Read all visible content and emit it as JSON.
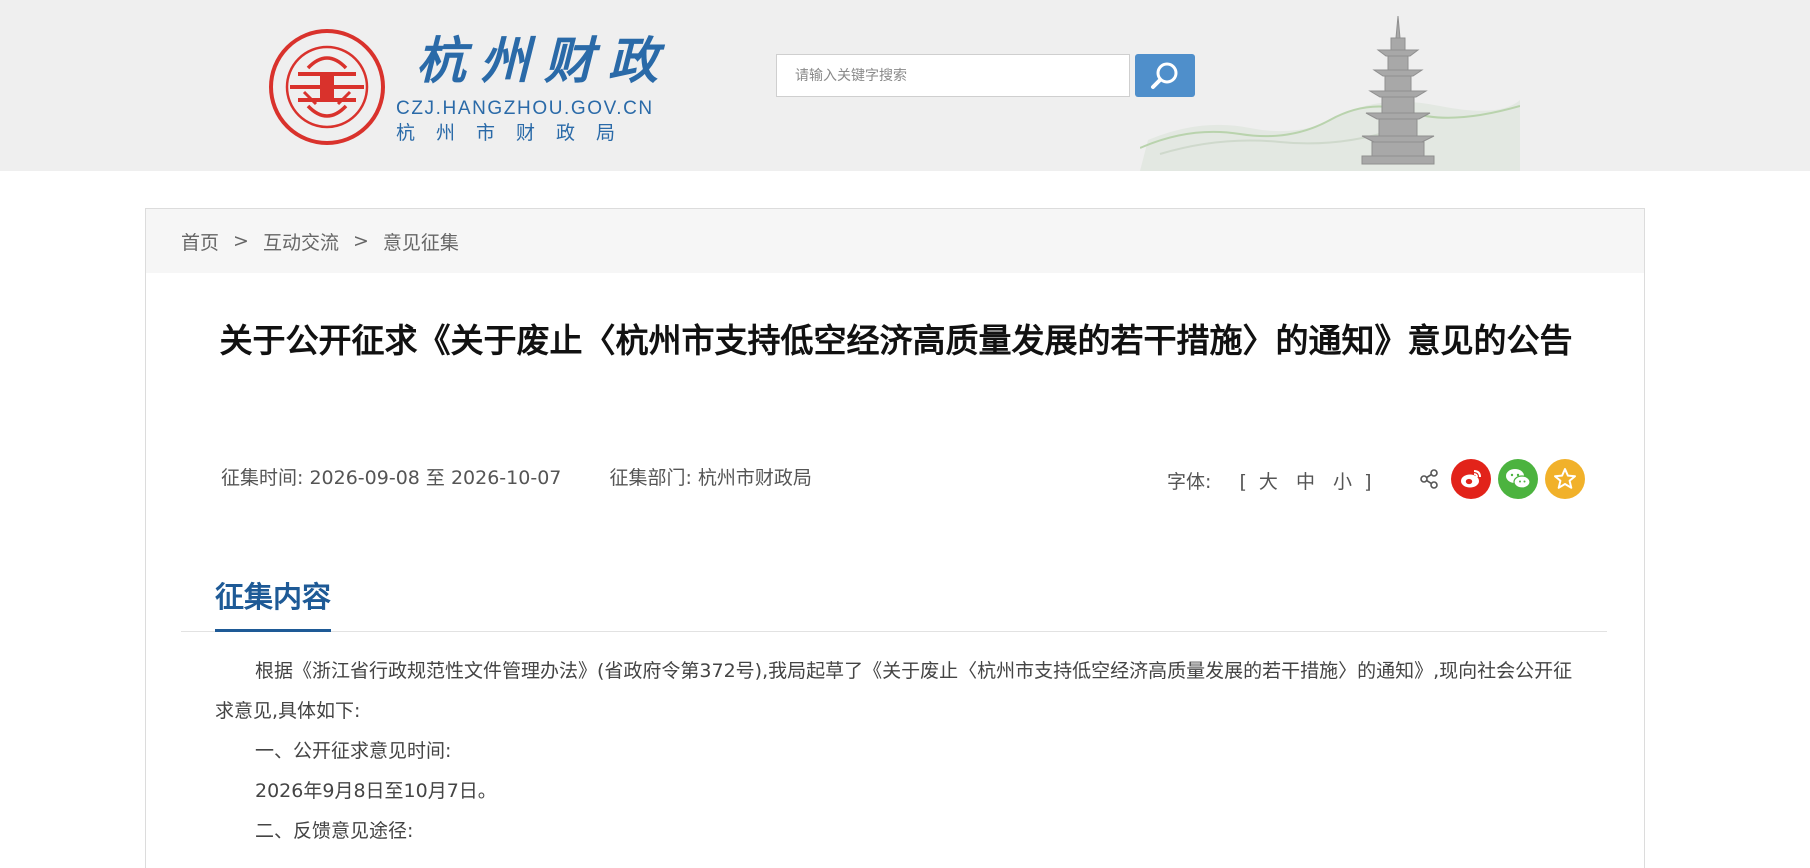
{
  "header": {
    "logo_title": "杭州财政",
    "logo_domain": "CZJ.HANGZHOU.GOV.CN",
    "logo_org": "杭州市财政局",
    "seal_text": "CZJ.HANGZHOU.GOV.CN 杭州财政",
    "search_placeholder": "请输入关键字搜索"
  },
  "breadcrumb": {
    "home": "首页",
    "sep": ">",
    "level1": "互动交流",
    "level2": "意见征集"
  },
  "article": {
    "title": "关于公开征求《关于废止〈杭州市支持低空经济高质量发展的若干措施〉的通知》意见的公告",
    "period_label": "征集时间:",
    "period_value": "2026-09-08 至 2026-10-07",
    "dept_label": "征集部门:",
    "dept_value": "杭州市财政局",
    "font_label": "字体:",
    "font_open": "[",
    "font_large": "大",
    "font_medium": "中",
    "font_small": "小",
    "font_close": "]",
    "section_title": "征集内容",
    "paragraphs": [
      "根据《浙江省行政规范性文件管理办法》(省政府令第372号),我局起草了《关于废止〈杭州市支持低空经济高质量发展的若干措施〉的通知》,现向社会公开征求意见,具体如下:",
      "一、公开征求意见时间:",
      "2026年9月8日至10月7日。",
      "二、反馈意见途径:"
    ]
  },
  "share": {
    "icons": [
      "share-icon",
      "weibo-icon",
      "wechat-icon",
      "favorite-icon"
    ],
    "colors": {
      "weibo": "#e2231a",
      "wechat": "#4cb33f",
      "favorite": "#f1b12a"
    }
  }
}
